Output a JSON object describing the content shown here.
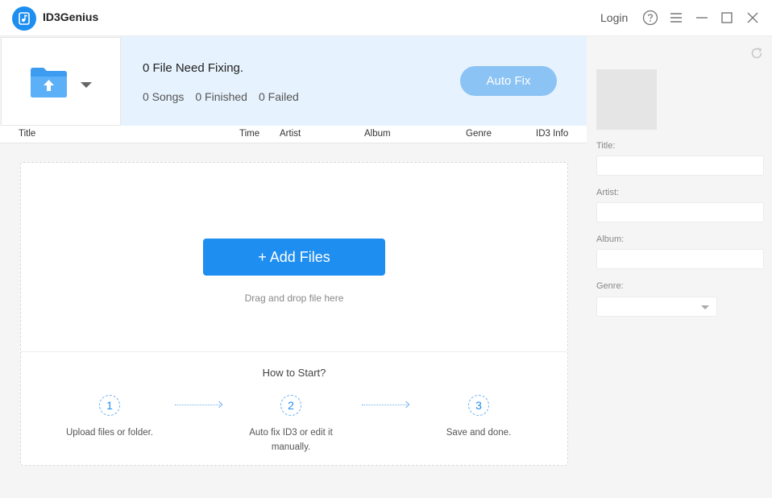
{
  "app": {
    "name": "ID3Genius"
  },
  "titlebar": {
    "login_label": "Login",
    "icons": [
      "help-icon",
      "menu-icon",
      "minimize-icon",
      "maximize-icon",
      "close-icon"
    ]
  },
  "status": {
    "need_fixing": "0 File Need Fixing.",
    "songs": "0 Songs",
    "finished": "0 Finished",
    "failed": "0 Failed",
    "auto_fix_label": "Auto Fix"
  },
  "columns": [
    "Title",
    "Time",
    "Artist",
    "Album",
    "Genre",
    "ID3 Info"
  ],
  "dropzone": {
    "add_files_label": "+ Add Files",
    "drag_text": "Drag and drop file here",
    "how_to_start": "How to Start?",
    "steps": [
      {
        "num": "1",
        "text": "Upload files or folder."
      },
      {
        "num": "2",
        "text": "Auto fix ID3 or edit it manually."
      },
      {
        "num": "3",
        "text": "Save and done."
      }
    ]
  },
  "side": {
    "title_label": "Title:",
    "title_value": "",
    "artist_label": "Artist:",
    "artist_value": "",
    "album_label": "Album:",
    "album_value": "",
    "genre_label": "Genre:",
    "genre_value": ""
  },
  "colors": {
    "accent": "#1e8ef0",
    "accent_disabled": "#8cc3f5",
    "status_bg": "#e6f2fd"
  }
}
